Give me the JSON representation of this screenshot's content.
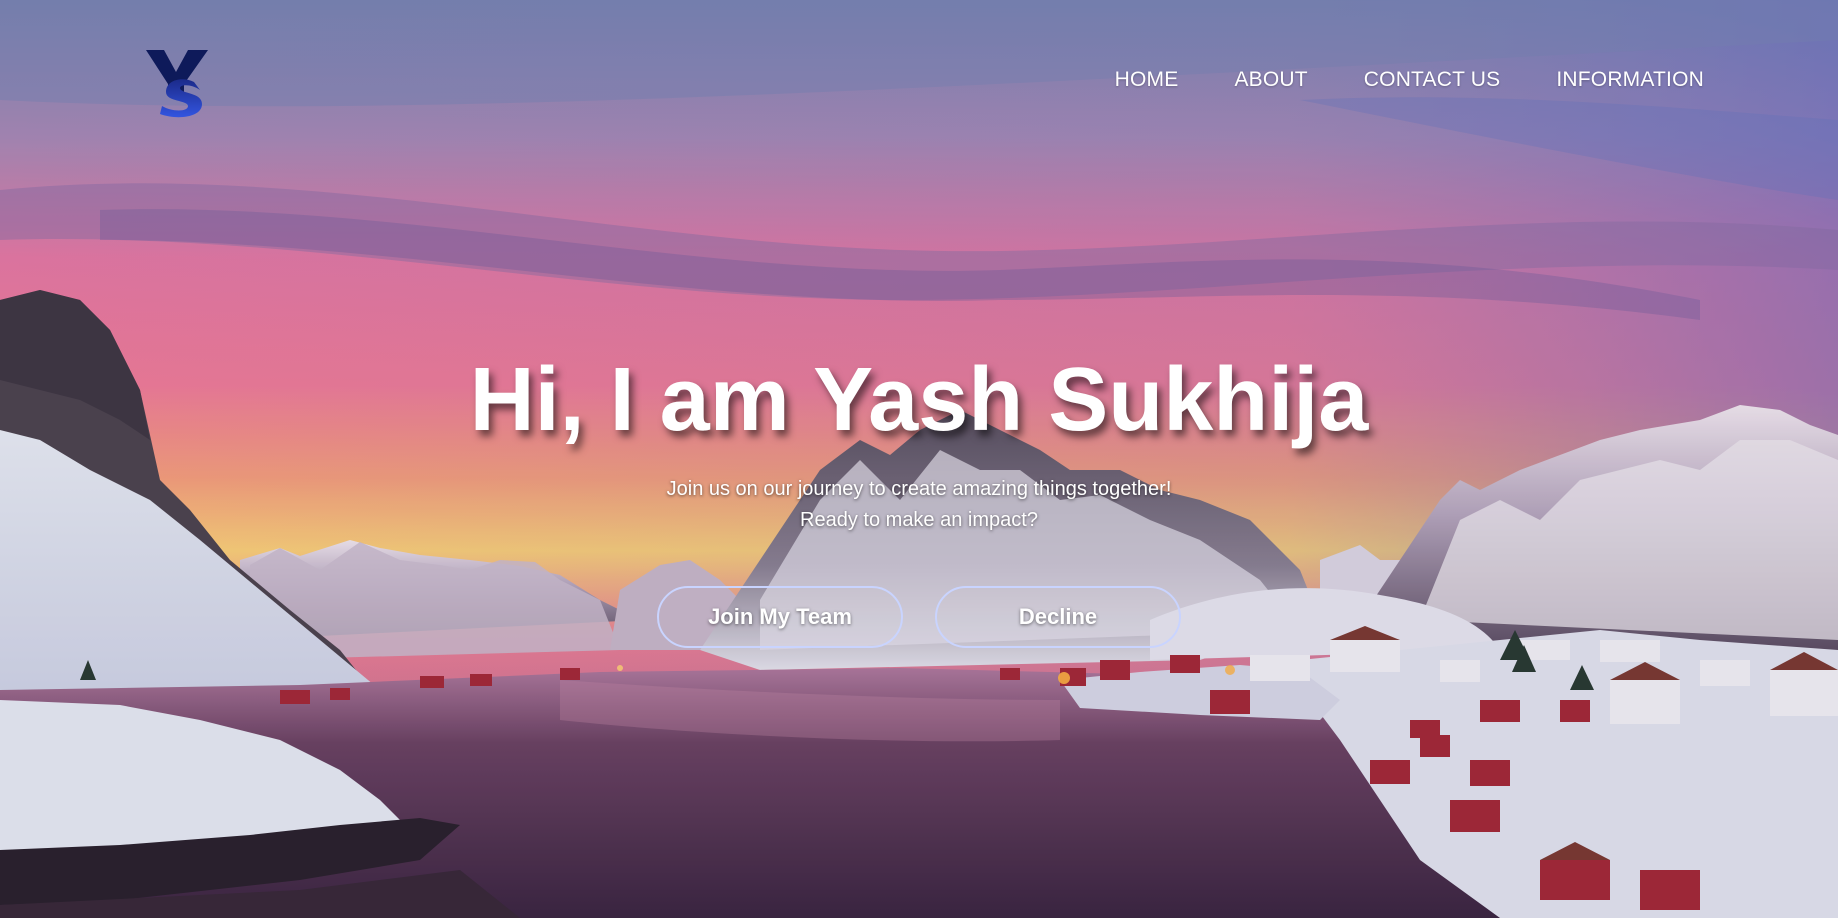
{
  "header": {
    "logo_text": "YS",
    "nav": [
      {
        "label": "HOME"
      },
      {
        "label": "ABOUT"
      },
      {
        "label": "CONTACT US"
      },
      {
        "label": "INFORMATION"
      }
    ]
  },
  "hero": {
    "title": "Hi, I am Yash Sukhija",
    "subtitle_line1": "Join us on our journey to create amazing things together!",
    "subtitle_line2": "Ready to make an impact?",
    "primary_button": "Join My Team",
    "secondary_button": "Decline"
  },
  "colors": {
    "sky_top": "#7f88b6",
    "sky_pink": "#f07aa6",
    "horizon_yellow": "#ffd27a",
    "water": "#5a3552",
    "snow": "#e7e6f4",
    "button_border": "#c9d4ff"
  }
}
